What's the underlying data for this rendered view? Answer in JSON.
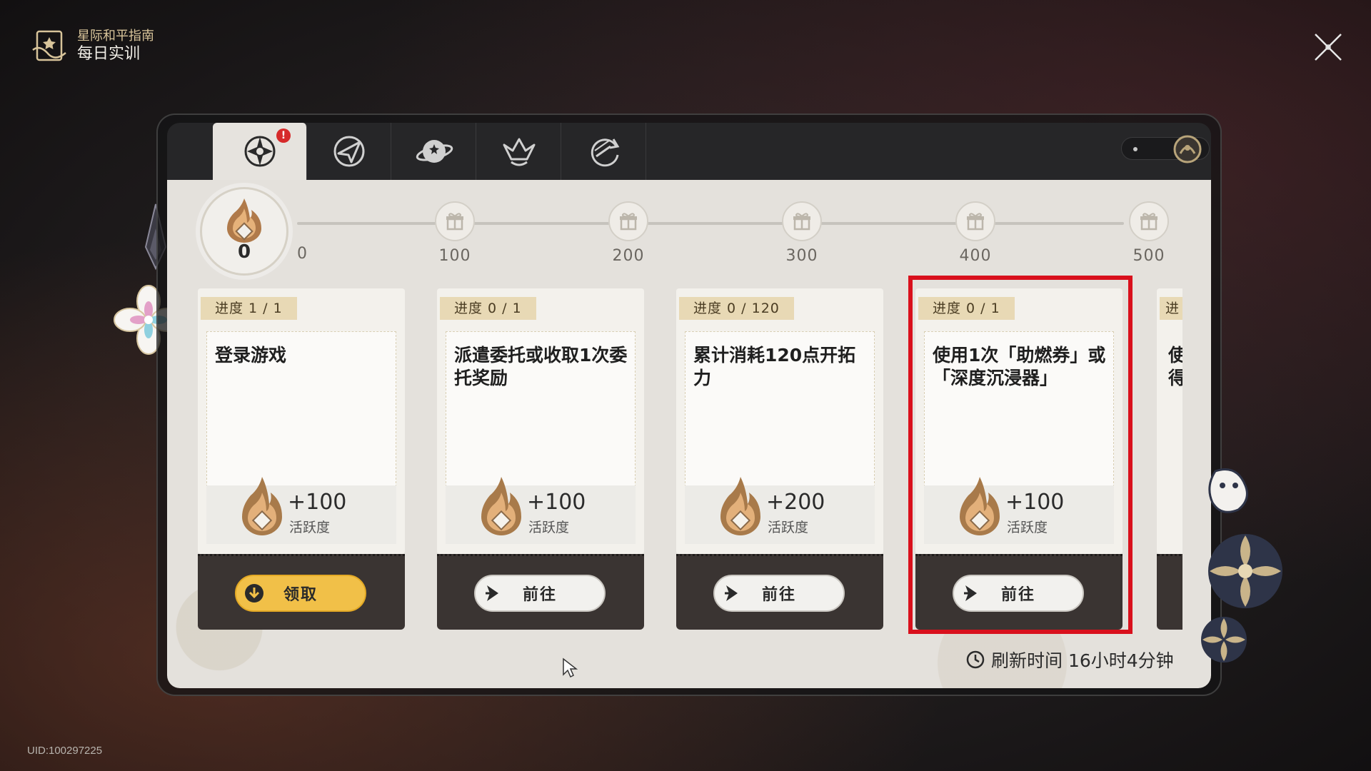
{
  "header": {
    "subtitle": "星际和平指南",
    "title": "每日实训",
    "icon": "guide-book-icon"
  },
  "close_icon": "close-icon",
  "uid": "UID:100297225",
  "tabs": [
    {
      "icon": "daily-training-icon",
      "active": true,
      "badge": "!"
    },
    {
      "icon": "compass-arrow-icon",
      "active": false
    },
    {
      "icon": "planet-icon",
      "active": false
    },
    {
      "icon": "crown-emblem-icon",
      "active": false
    },
    {
      "icon": "cycle-arrow-icon",
      "active": false
    }
  ],
  "activity": {
    "current": "0",
    "start_label": "0",
    "milestones": [
      "100",
      "200",
      "300",
      "400",
      "500"
    ],
    "current_progress_fraction": 0
  },
  "tasks": [
    {
      "progress": "进度  1 / 1",
      "title": "登录游戏",
      "reward_value": "+100",
      "reward_unit": "活跃度",
      "button": "领取",
      "button_type": "claim"
    },
    {
      "progress": "进度  0 / 1",
      "title": "派遣委托或收取1次委托奖励",
      "reward_value": "+100",
      "reward_unit": "活跃度",
      "button": "前往",
      "button_type": "go"
    },
    {
      "progress": "进度  0 / 120",
      "title": "累计消耗120点开拓力",
      "reward_value": "+200",
      "reward_unit": "活跃度",
      "button": "前往",
      "button_type": "go"
    },
    {
      "progress": "进度  0 / 1",
      "title": "使用1次「助燃券」或「深度沉浸器」",
      "reward_value": "+100",
      "reward_unit": "活跃度",
      "button": "前往",
      "button_type": "go",
      "highlighted": true
    }
  ],
  "peek_card": {
    "progress": "进",
    "title": "使\n得"
  },
  "refresh": {
    "text": "刷新时间 16小时4分钟",
    "icon": "clock-icon"
  },
  "colors": {
    "highlight": "#d9101c",
    "claim_button": "#f1c048",
    "progress_tag": "#e8d9b5",
    "badge": "#d62a2a"
  }
}
